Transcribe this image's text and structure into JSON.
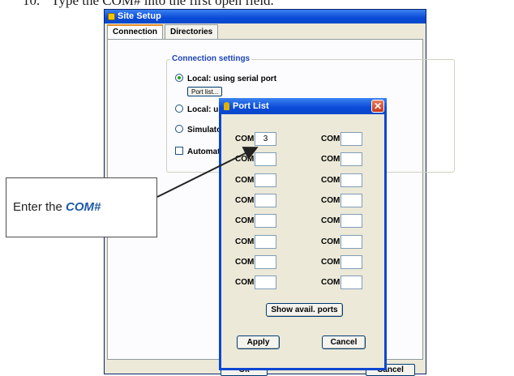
{
  "doc": {
    "step_number": "10.",
    "instruction": "Type the COM# into the first open field."
  },
  "window": {
    "title": "Site Setup",
    "tabs": [
      "Connection",
      "Directories"
    ],
    "group_label": "Connection settings",
    "option_local_serial": "Local: using serial port",
    "port_list_button": "Port list...",
    "option_local_partial": "Local: us",
    "option_simulator_partial": "Simulator",
    "option_auto_partial": "Automati",
    "ok_button": "Ok",
    "cancel_button": "Cancel"
  },
  "dialog": {
    "title": "Port List",
    "com_label": "COM",
    "left_values": [
      "3",
      "",
      "",
      "",
      "",
      "",
      "",
      ""
    ],
    "right_values": [
      "",
      "",
      "",
      "",
      "",
      "",
      "",
      ""
    ],
    "show_ports_button": "Show avail. ports",
    "apply_button": "Apply",
    "cancel_button": "Cancel"
  },
  "callout": {
    "prefix": "Enter the",
    "emphasis": "COM#"
  },
  "colors": {
    "titlebar": "#0a4ad8",
    "dialog_border": "#0b46d1",
    "close_button": "#c8381c",
    "callout_emphasis": "#1e5aa8"
  }
}
